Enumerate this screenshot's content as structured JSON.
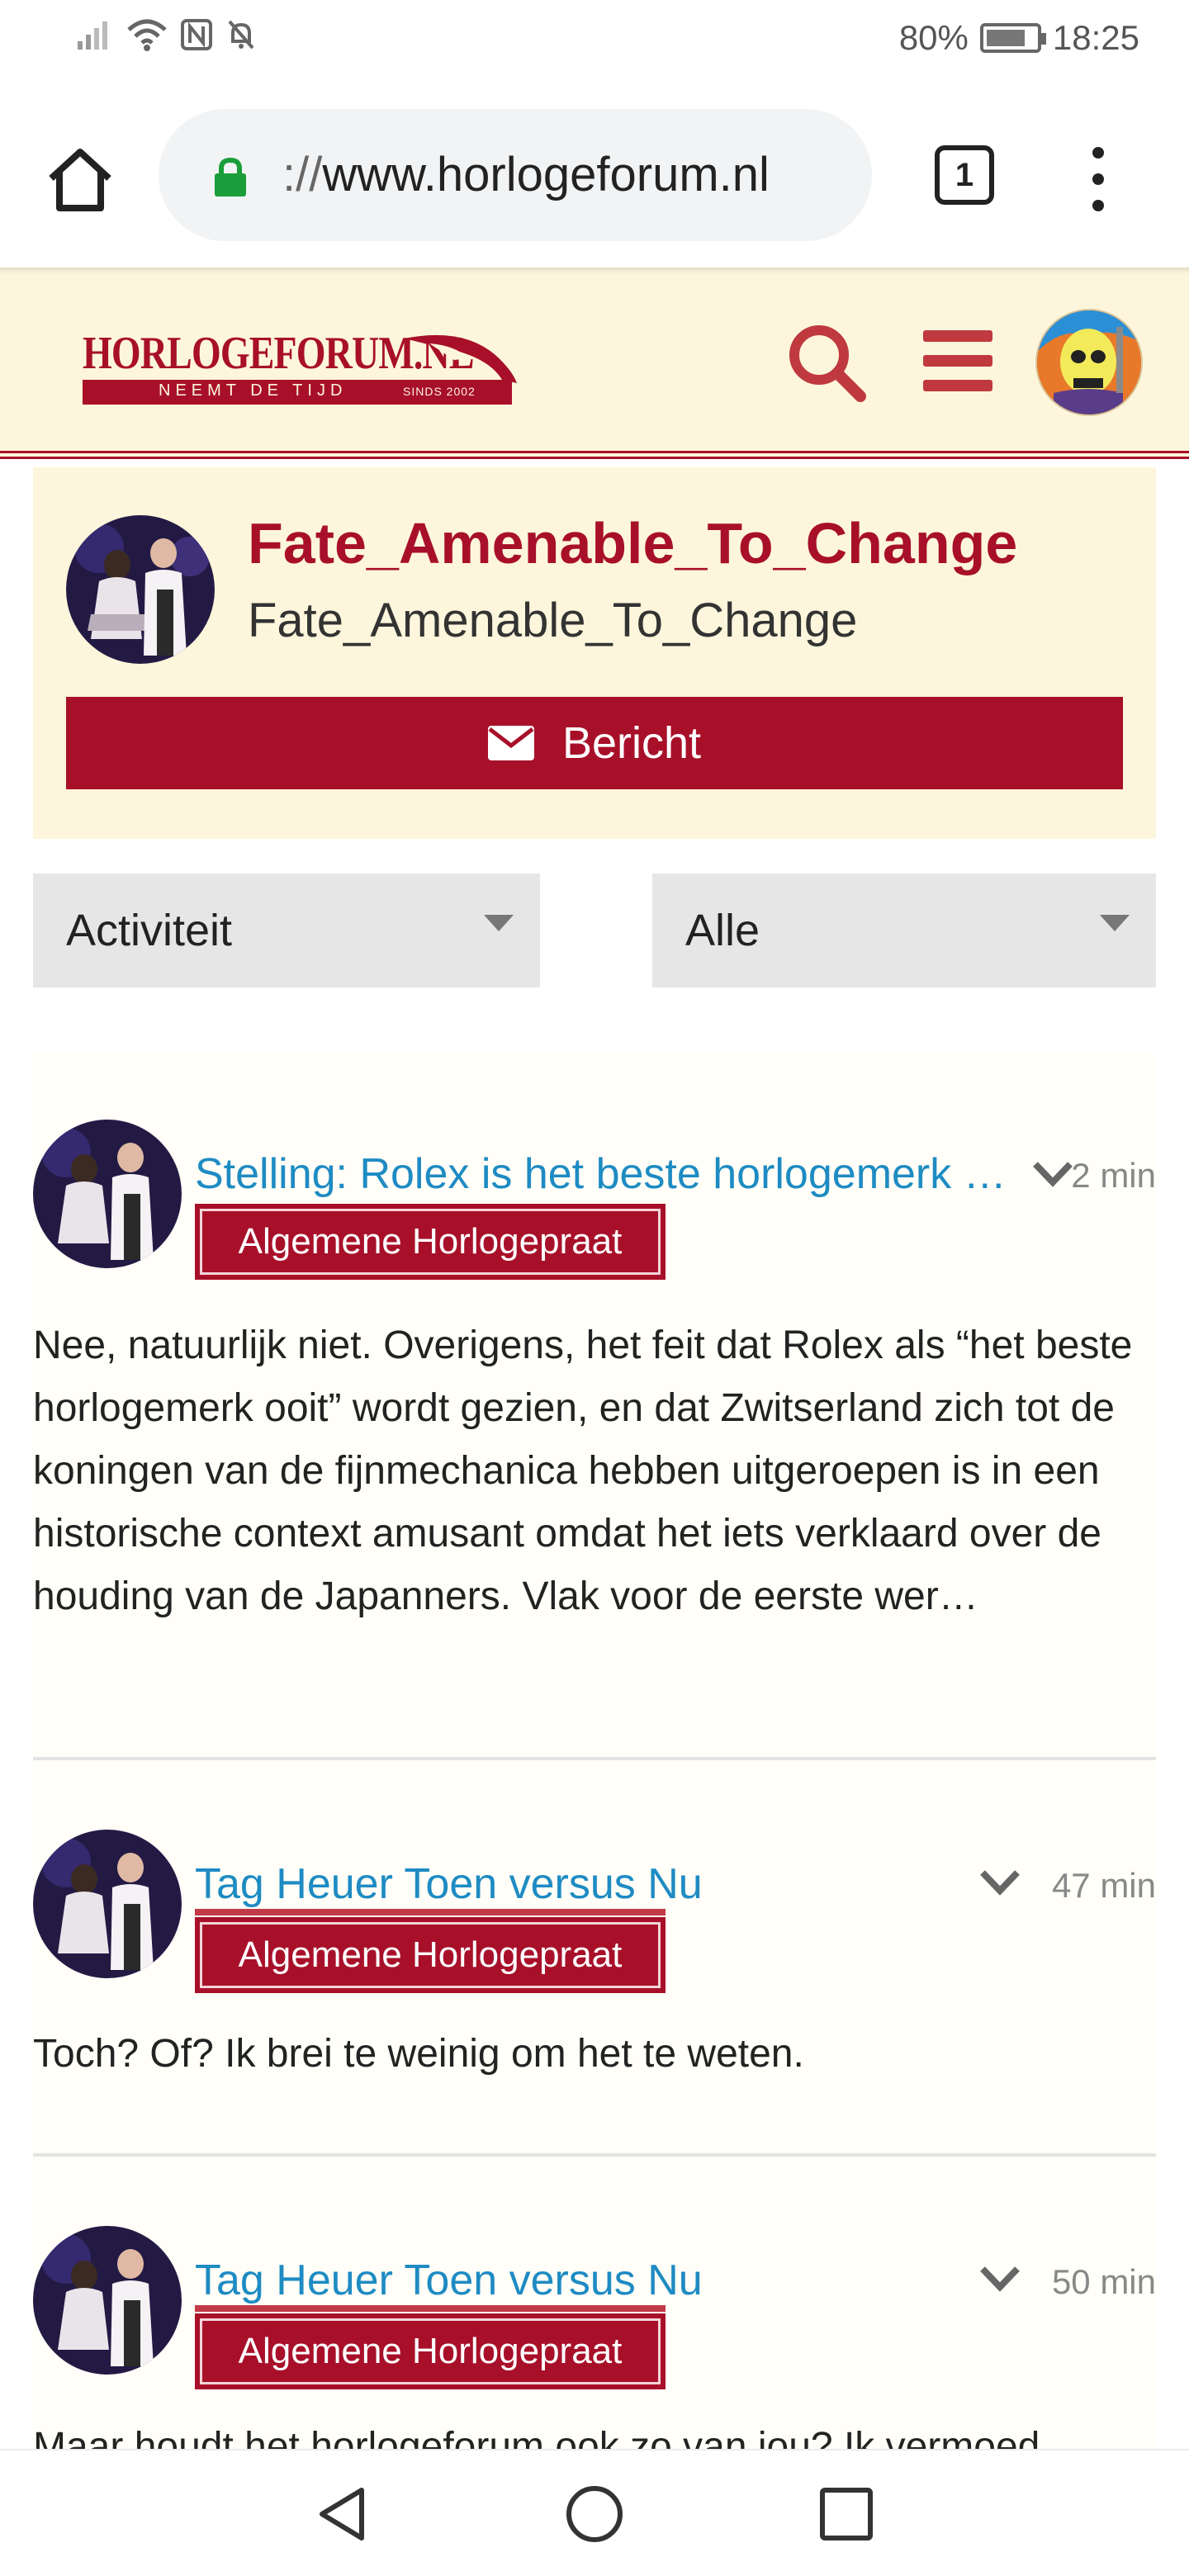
{
  "status_bar": {
    "battery_percent": "80%",
    "time": "18:25",
    "icons": [
      "signal-icon",
      "wifi-icon",
      "nfc-icon",
      "bell-off-icon",
      "battery-icon"
    ]
  },
  "browser": {
    "url_scheme": "://",
    "url_host": "www.horlogeforum.nl",
    "tab_count": "1",
    "icons": [
      "home-icon",
      "lock-icon",
      "tabs-icon",
      "overflow-menu-icon"
    ]
  },
  "site_header": {
    "logo_title": "HORLOGEFORUM.NL",
    "logo_tagline": "NEEMT DE TIJD",
    "logo_since": "SINDS 2002",
    "icons": [
      "search-icon",
      "hamburger-menu-icon",
      "user-avatar-icon"
    ],
    "accent_color": "#a8102a",
    "background_color": "#fdf6dc"
  },
  "profile": {
    "display_name": "Fate_Amenable_To_Change",
    "username": "Fate_Amenable_To_Change",
    "message_button_label": "Bericht"
  },
  "filters": {
    "activity": "Activiteit",
    "scope": "Alle"
  },
  "feed": {
    "posts": [
      {
        "title": "Stelling: Rolex is het beste horlogemerk ooit",
        "time": "2 min",
        "category": "Algemene Horlogepraat",
        "body": "Nee, natuurlijk niet. Overigens, het feit dat Rolex als “het beste horlogemerk ooit” wordt gezien, en dat Zwitserland zich tot de koningen van de fijnmechanica hebben uitgeroepen is in een historische context amusant omdat het iets verklaard over de houding van de Japanners. Vlak voor de eerste wer…"
      },
      {
        "title": "Tag Heuer Toen versus Nu",
        "time": "47 min",
        "category": "Algemene Horlogepraat",
        "body": "Toch? Of? Ik brei te weinig om het te weten."
      },
      {
        "title": "Tag Heuer Toen versus Nu",
        "time": "50 min",
        "category": "Algemene Horlogepraat",
        "body": "Maar houdt het horlogeforum ook zo van jou? Ik vermoed"
      }
    ]
  },
  "nav_bar": {
    "icons": [
      "back-icon",
      "home-circle-icon",
      "recents-icon"
    ]
  }
}
